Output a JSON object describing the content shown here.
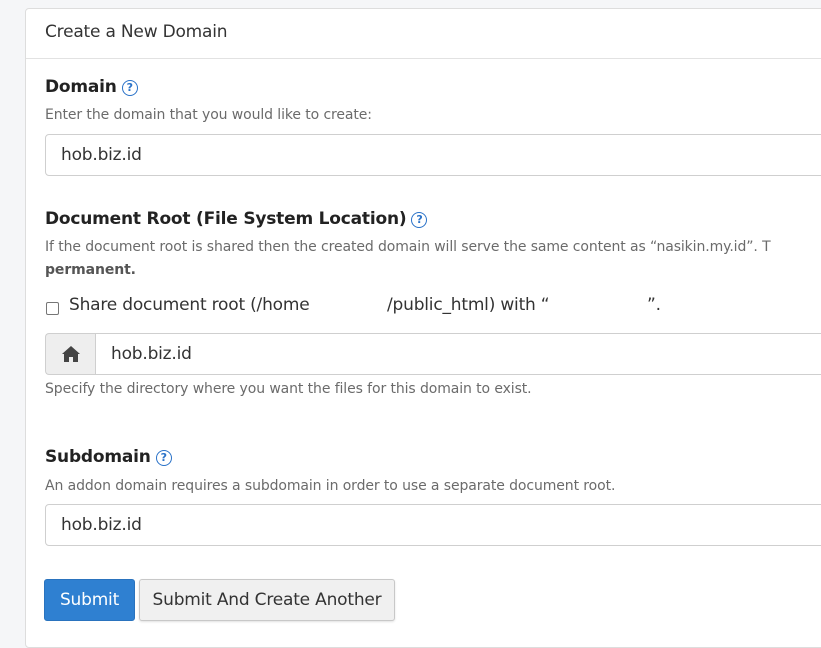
{
  "panel": {
    "title": "Create a New Domain"
  },
  "domain_section": {
    "label": "Domain",
    "help_text": "Enter the domain that you would like to create:",
    "value": "hob.biz.id"
  },
  "docroot_section": {
    "label": "Document Root (File System Location)",
    "description": "If the document root is shared then the created domain will serve the same content as “nasikin.my.id”. T",
    "description_bold": "permanent.",
    "share_checkbox": {
      "checked": false,
      "label_prefix": "Share document root (/home",
      "label_middle": "/public_html) with “",
      "label_suffix": "”."
    },
    "value": "hob.biz.id",
    "help_text": "Specify the directory where you want the files for this domain to exist."
  },
  "subdomain_section": {
    "label": "Subdomain",
    "help_text": "An addon domain requires a subdomain in order to use a separate document root.",
    "value": "hob.biz.id"
  },
  "actions": {
    "submit_label": "Submit",
    "submit_another_label": "Submit And Create Another"
  },
  "colors": {
    "primary": "#2f80d1",
    "help_icon": "#2a72c8"
  },
  "icons": {
    "help": "question-circle-icon",
    "home": "home-icon"
  }
}
